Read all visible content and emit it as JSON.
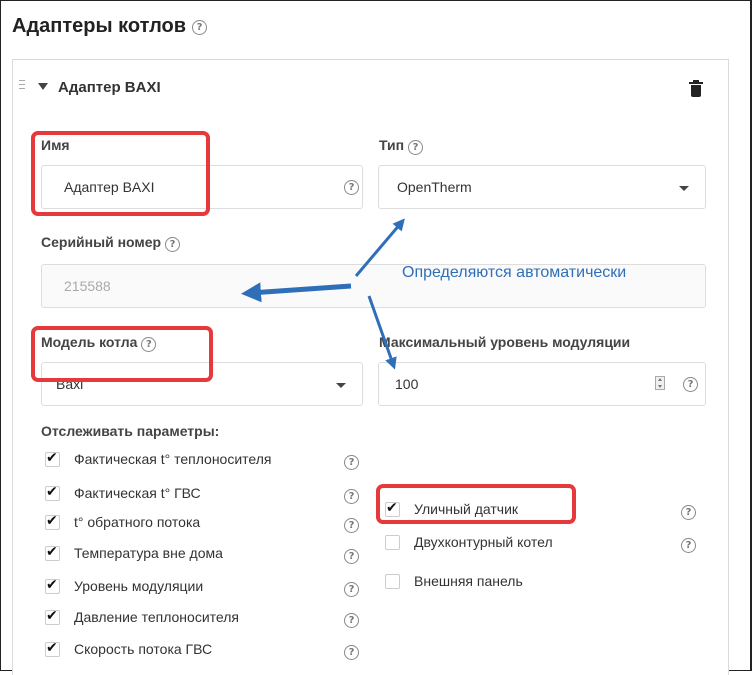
{
  "title": "Адаптеры котлов",
  "title_help_icon": "help-circle-icon",
  "panel": {
    "title": "Адаптер BAXI",
    "trash_icon": "trash-icon"
  },
  "fields": {
    "name": {
      "label": "Имя",
      "value": "Адаптер BAXI"
    },
    "type": {
      "label": "Тип",
      "value": "OpenTherm"
    },
    "serial": {
      "label": "Серийный номер",
      "value": "215588"
    },
    "model": {
      "label": "Модель котла",
      "value": "Baxi"
    },
    "modulation": {
      "label": "Максимальный уровень модуляции",
      "value": "100"
    }
  },
  "annotation_text": "Определяются автоматически",
  "track": {
    "heading": "Отслеживать параметры:",
    "items": [
      {
        "label": "Фактическая t° теплоносителя",
        "checked": true
      },
      {
        "label": "Фактическая t° ГВС",
        "checked": true
      },
      {
        "label": "t° обратного потока",
        "checked": true
      },
      {
        "label": "Температура вне дома",
        "checked": true
      },
      {
        "label": "Уровень модуляции",
        "checked": true
      },
      {
        "label": "Давление теплоносителя",
        "checked": true
      },
      {
        "label": "Скорость потока ГВС",
        "checked": true
      }
    ]
  },
  "extra": {
    "items": [
      {
        "label": "Уличный датчик",
        "checked": true
      },
      {
        "label": "Двухконтурный котел",
        "checked": false
      },
      {
        "label": "Внешняя панель",
        "checked": false
      }
    ]
  },
  "colors": {
    "highlight": "#e5393b",
    "arrow": "#2e6fb8"
  }
}
